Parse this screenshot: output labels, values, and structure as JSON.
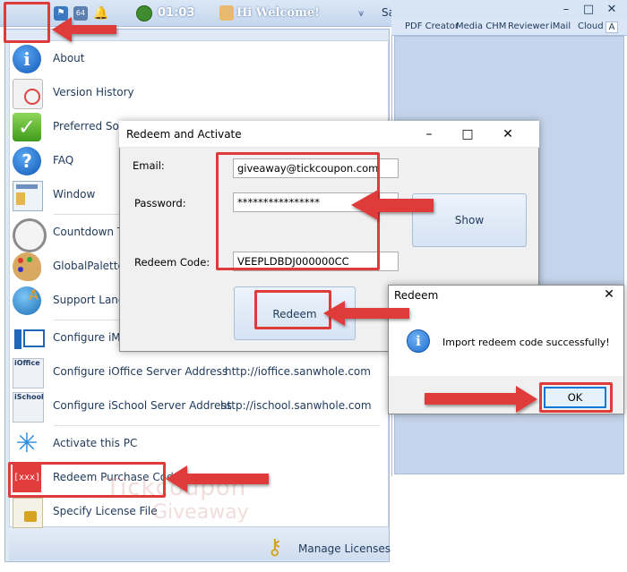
{
  "topbar": {
    "clock": "01:03",
    "welcome": "Hi Welcome!",
    "search_partial": "Sa",
    "badge_64": "64"
  },
  "right_window": {
    "tabs": [
      "PDF Creator",
      "Media CHM",
      "Reviewer",
      "iMail",
      "Cloud",
      "A"
    ],
    "minimize": "–",
    "maximize": "□",
    "close": "✕"
  },
  "menu": {
    "items": [
      {
        "label": "About",
        "icon": "info-icon"
      },
      {
        "label": "Version History",
        "icon": "history-icon"
      },
      {
        "label": "Preferred Soft",
        "icon": "checkmark-icon"
      },
      {
        "label": "FAQ",
        "icon": "question-icon"
      },
      {
        "label": "Window",
        "icon": "window-icon"
      },
      {
        "label": "Countdown Ti",
        "icon": "stopwatch-icon"
      },
      {
        "label": "GlobalPalette",
        "icon": "palette-icon"
      },
      {
        "label": "Support Langu",
        "icon": "globe-icon"
      },
      {
        "label": "Configure iMa",
        "icon": "imail-icon"
      },
      {
        "label": "Configure iOffice Server Address",
        "url": "http://ioffice.sanwhole.com",
        "icon": "ioffice-icon",
        "icon_text": "iOffice"
      },
      {
        "label": "Configure iSchool Server Address",
        "url": "http://ischool.sanwhole.com",
        "icon": "ischool-icon",
        "icon_text": "iSchool"
      },
      {
        "label": "Activate this PC",
        "icon": "star-icon"
      },
      {
        "label": "Redeem Purchase Code",
        "icon": "code-icon",
        "icon_text": "[xxx]"
      },
      {
        "label": "Specify License File",
        "icon": "license-icon"
      }
    ],
    "footer": {
      "manage": "Manage Licenses"
    }
  },
  "redeem_dialog": {
    "title": "Redeem and Activate",
    "email_label": "Email:",
    "email_value": "giveaway@tickcoupon.com",
    "password_label": "Password:",
    "password_value": "****************",
    "code_label": "Redeem Code:",
    "code_value": "VEEPLDBDJ000000CC",
    "show_button": "Show",
    "redeem_button": "Redeem",
    "close": "✕",
    "maximize": "□",
    "minimize": "–"
  },
  "message_box": {
    "title": "Redeem",
    "text": "Import redeem code successfully!",
    "ok": "OK",
    "info_glyph": "i",
    "close": "✕"
  },
  "watermark": {
    "line1": "Tickcoupon",
    "line2": "Giveaway"
  },
  "colors": {
    "annotation_red": "#e03b3b",
    "accent_blue": "#0078d7",
    "menu_text": "#1e395b"
  }
}
